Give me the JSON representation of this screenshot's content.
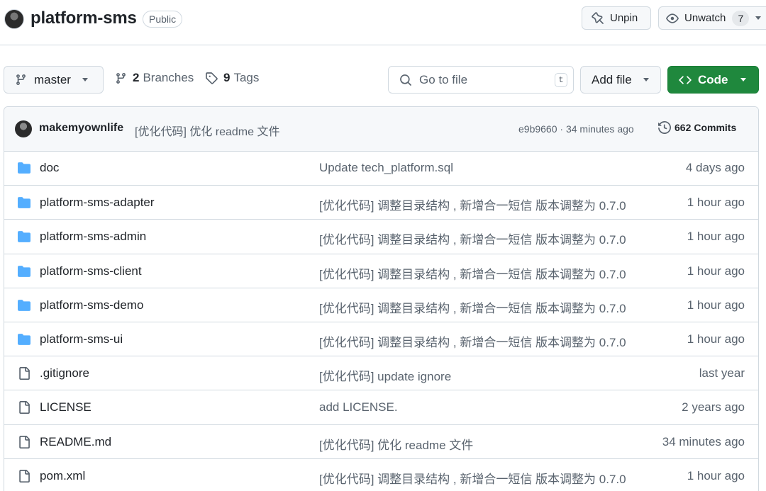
{
  "repo": {
    "name": "platform-sms",
    "visibility": "Public"
  },
  "header_actions": {
    "unpin_label": "Unpin",
    "unwatch_label": "Unwatch",
    "watch_count": "7"
  },
  "toolbar": {
    "branch": "master",
    "branches_count": "2",
    "branches_label": "Branches",
    "tags_count": "9",
    "tags_label": "Tags",
    "goto_placeholder": "Go to file",
    "goto_shortcut": "t",
    "add_file_label": "Add file",
    "code_label": "Code"
  },
  "latest_commit": {
    "author": "makemyownlife",
    "message": "[优化代码] 优化 readme 文件",
    "meta": "e9b9660 · 34 minutes ago",
    "commits_count": "662",
    "commits_label": "Commits"
  },
  "files": [
    {
      "type": "folder",
      "name": "doc",
      "message": "Update tech_platform.sql",
      "age": "4 days ago"
    },
    {
      "type": "folder",
      "name": "platform-sms-adapter",
      "message": "[优化代码] 调整目录结构 , 新增合一短信 版本调整为 0.7.0",
      "age": "1 hour ago"
    },
    {
      "type": "folder",
      "name": "platform-sms-admin",
      "message": "[优化代码] 调整目录结构 , 新增合一短信 版本调整为 0.7.0",
      "age": "1 hour ago"
    },
    {
      "type": "folder",
      "name": "platform-sms-client",
      "message": "[优化代码] 调整目录结构 , 新增合一短信 版本调整为 0.7.0",
      "age": "1 hour ago"
    },
    {
      "type": "folder",
      "name": "platform-sms-demo",
      "message": "[优化代码] 调整目录结构 , 新增合一短信 版本调整为 0.7.0",
      "age": "1 hour ago"
    },
    {
      "type": "folder",
      "name": "platform-sms-ui",
      "message": "[优化代码] 调整目录结构 , 新增合一短信 版本调整为 0.7.0",
      "age": "1 hour ago"
    },
    {
      "type": "file",
      "name": ".gitignore",
      "message": "[优化代码] update ignore",
      "age": "last year"
    },
    {
      "type": "file",
      "name": "LICENSE",
      "message": "add LICENSE.",
      "age": "2 years ago"
    },
    {
      "type": "file",
      "name": "README.md",
      "message": "[优化代码] 优化 readme 文件",
      "age": "34 minutes ago"
    },
    {
      "type": "file",
      "name": "pom.xml",
      "message": "[优化代码] 调整目录结构 , 新增合一短信 版本调整为 0.7.0",
      "age": "1 hour ago"
    }
  ],
  "colors": {
    "folder_icon": "#54aeff",
    "code_button": "#1f883d"
  }
}
